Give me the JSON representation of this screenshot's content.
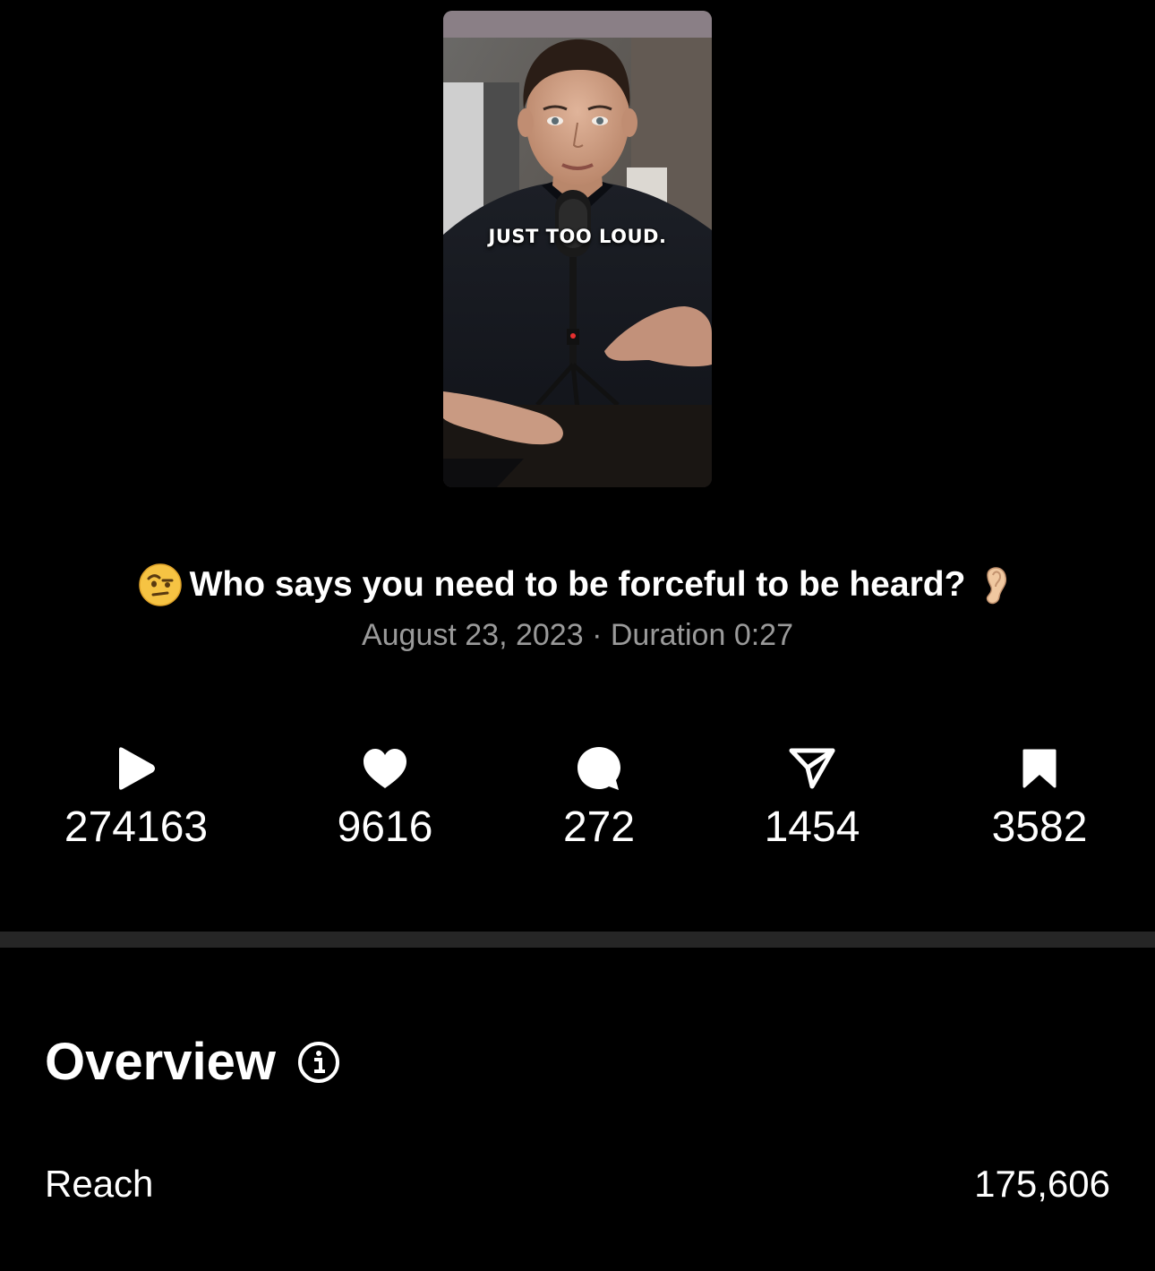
{
  "thumbnail": {
    "caption": "JUST TOO LOUD."
  },
  "post": {
    "leading_emoji": "face-with-raised-eyebrow",
    "title": "Who says you need to be forceful to be heard?",
    "trailing_emoji": "ear",
    "date": "August 23, 2023",
    "separator": "·",
    "duration_label": "Duration",
    "duration": "0:27"
  },
  "stats": [
    {
      "icon": "play-icon",
      "value": "274163"
    },
    {
      "icon": "heart-icon",
      "value": "9616"
    },
    {
      "icon": "comment-icon",
      "value": "272"
    },
    {
      "icon": "share-icon",
      "value": "1454"
    },
    {
      "icon": "bookmark-icon",
      "value": "3582"
    }
  ],
  "overview": {
    "title": "Overview",
    "info_icon": "info-icon",
    "reach_label": "Reach",
    "reach_value": "175,606"
  },
  "colors": {
    "background": "#000000",
    "text": "#ffffff",
    "muted": "#9a9a9a",
    "divider": "#262626"
  }
}
